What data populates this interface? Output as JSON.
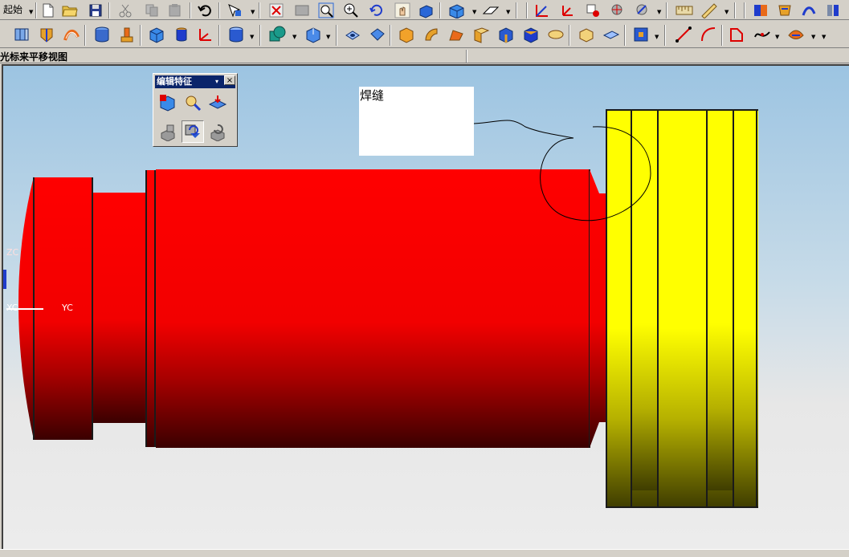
{
  "toolbar_top": {
    "start_label": "起始",
    "icons": [
      "new-file-icon",
      "open-folder-icon",
      "save-icon",
      "cut-icon",
      "copy-icon",
      "paste-icon",
      "undo-icon",
      "select-filter-icon",
      "fit-view-icon",
      "zoom-window-icon",
      "zoom-icon",
      "zoom-in-icon",
      "rotate-icon",
      "pan-icon",
      "shade-icon",
      "render-style-icon",
      "wcs-icon",
      "layer-icon",
      "csys-icon",
      "snap-icon",
      "snap-options-icon",
      "measure-icon",
      "analysis-icon",
      "assembly-icon",
      "sheet-icon",
      "save-all-icon"
    ]
  },
  "toolbar_features": {
    "icons": [
      "extrude-icon",
      "revolve-icon",
      "sweep-icon",
      "cylinder-icon",
      "boss-icon",
      "block-icon",
      "cone-icon",
      "datum-csys-icon",
      "cylinder-solid-icon",
      "unite-icon",
      "shell-icon",
      "hole-icon",
      "pocket-icon",
      "pad-icon",
      "blend-icon",
      "chamfer-icon",
      "draft-icon",
      "offset-face-icon",
      "solid-face-icon",
      "thicken-icon",
      "sew-icon",
      "patch-icon",
      "trim-body-icon",
      "line-icon",
      "arc-icon",
      "curve-icon",
      "spline-icon",
      "surface-icon"
    ]
  },
  "status": {
    "prompt": "光标来平移视图"
  },
  "edit_feature_palette": {
    "title": "编辑特征",
    "menu_glyph": "▾",
    "close_glyph": "×"
  },
  "viewport": {
    "annotation_label": "焊缝",
    "axis_zc": "ZC",
    "axis_yc": "YC",
    "axis_xc": "XC",
    "colors": {
      "red_part": "#ff0000",
      "yellow_part": "#ffff00",
      "background_top": "#9cc4e2",
      "background_bottom": "#ececec"
    }
  }
}
